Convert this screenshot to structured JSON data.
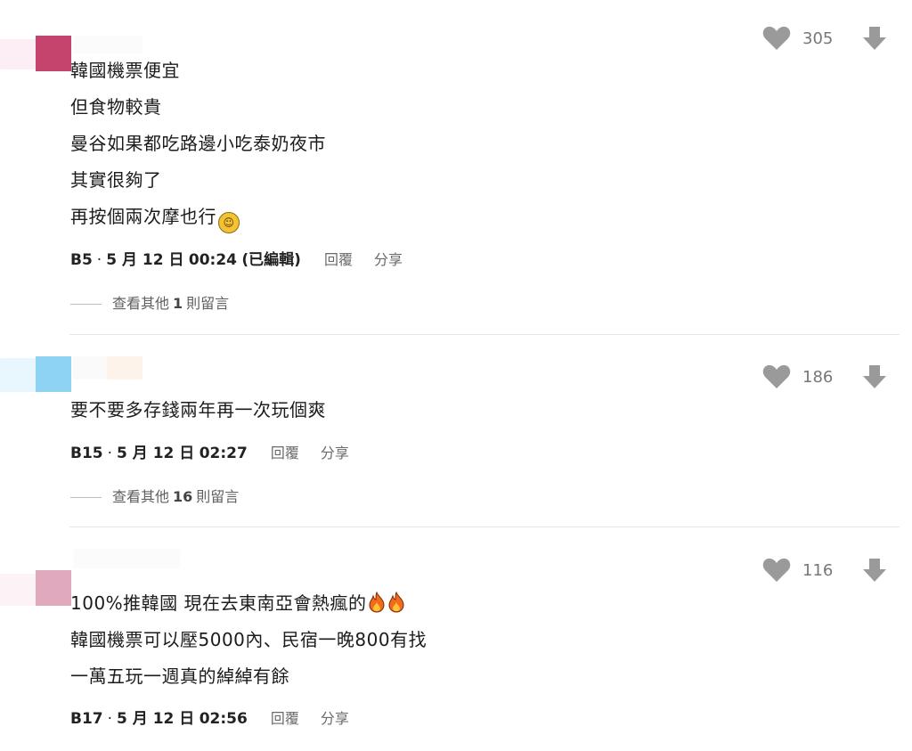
{
  "comments": [
    {
      "lines": [
        "韓國機票便宜",
        "但食物較貴",
        "曼谷如果都吃路邊小吃泰奶夜市",
        "其實很夠了",
        "再按個兩次摩也行"
      ],
      "floor": "B5",
      "date": "5 月 12 日",
      "time": "00:24",
      "edited": "(已編輯)",
      "likes": "305",
      "reply_label": "回覆",
      "share_label": "分享",
      "more_prefix": "查看其他",
      "more_count": "1",
      "more_suffix": "則留言",
      "avatar_color": "#c4446d"
    },
    {
      "lines": [
        "要不要多存錢兩年再一次玩個爽"
      ],
      "floor": "B15",
      "date": "5 月 12 日",
      "time": "02:27",
      "likes": "186",
      "reply_label": "回覆",
      "share_label": "分享",
      "more_prefix": "查看其他",
      "more_count": "16",
      "more_suffix": "則留言",
      "avatar_color": "#8fd3f4"
    },
    {
      "lines": [
        "100%推韓國 現在去東南亞會熱瘋的",
        "韓國機票可以壓5000內、民宿一晚800有找",
        "一萬五玩一週真的綽綽有餘"
      ],
      "floor": "B17",
      "date": "5 月 12 日",
      "time": "02:56",
      "likes": "116",
      "reply_label": "回覆",
      "share_label": "分享",
      "avatar_color": "#e0a9bd"
    }
  ],
  "icons": {
    "like": "heart-icon",
    "dislike": "down-arrow-icon",
    "emoji_laugh": "laughing-emoji",
    "emoji_fire": "fire-emoji"
  },
  "colors": {
    "icon_gray": "#9a9a9a",
    "divider": "#e6e6e6",
    "meta_action": "#6a6a6a"
  }
}
